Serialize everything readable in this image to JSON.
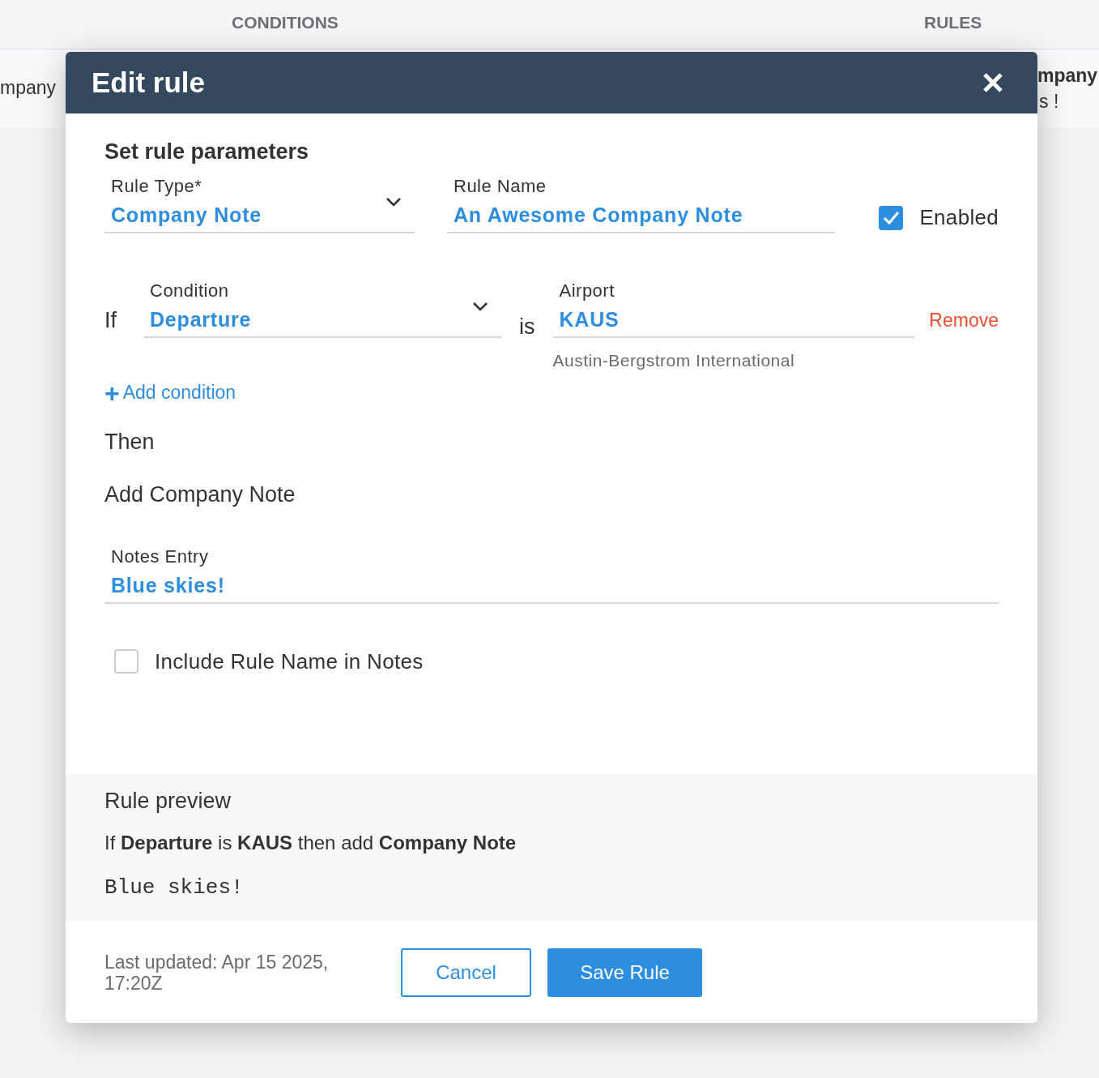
{
  "background": {
    "columns": [
      "CONDITIONS",
      "RULES"
    ],
    "left_cell": "mpany",
    "right_cell": {
      "title": "mpany",
      "note": "s !"
    }
  },
  "dialog": {
    "title": "Edit rule",
    "section_title": "Set rule parameters",
    "rule_type": {
      "label": "Rule Type*",
      "value": "Company Note"
    },
    "rule_name": {
      "label": "Rule Name",
      "value": "An Awesome Company Note"
    },
    "enabled": {
      "label": "Enabled",
      "checked": true
    },
    "conditions": [
      {
        "prefix": "If",
        "field": {
          "label": "Condition",
          "value": "Departure"
        },
        "operator": "is",
        "target": {
          "label": "Airport",
          "value": "KAUS",
          "hint": "Austin-Bergstrom International"
        },
        "remove": "Remove"
      }
    ],
    "add_condition": {
      "icon": "+",
      "label": "Add condition"
    },
    "then_label": "Then",
    "action_title": "Add Company Note",
    "notes_entry": {
      "label": "Notes Entry",
      "value": "Blue skies!"
    },
    "include_rule_name": {
      "label": "Include Rule Name in Notes",
      "checked": false
    },
    "preview": {
      "title": "Rule preview",
      "sentence": "If **Departure** is **KAUS** then add **Company Note**",
      "note": "Blue skies!"
    },
    "last_updated": "Last updated: Apr 15 2025, 17:20Z",
    "buttons": [
      {
        "label": "Cancel",
        "kind": "secondary"
      },
      {
        "label": "Save Rule",
        "kind": "primary"
      }
    ]
  }
}
